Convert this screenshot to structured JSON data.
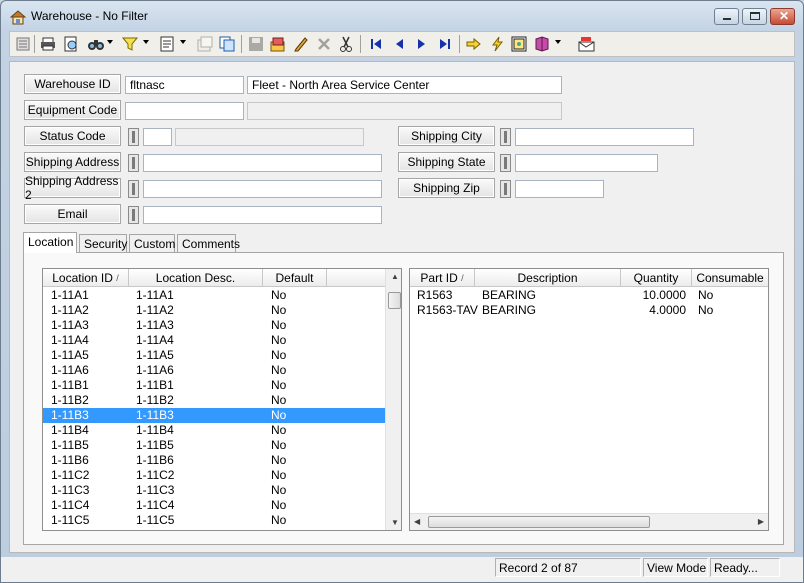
{
  "window": {
    "title": "Warehouse - No Filter"
  },
  "toolbar": {
    "icons": [
      "list-icon",
      "print-icon",
      "print-preview-icon",
      "binoculars-icon",
      "filter-icon",
      "report-icon",
      "properties-icon",
      "copy-icon",
      "save-icon",
      "new-record-icon",
      "edit-icon",
      "delete-icon",
      "cut-icon",
      "first-record-icon",
      "previous-record-icon",
      "next-record-icon",
      "last-record-icon",
      "arrow-action-icon",
      "lightning-icon",
      "picture-icon",
      "book-icon",
      "mail-icon"
    ]
  },
  "form": {
    "warehouse_id": {
      "label": "Warehouse ID",
      "value": "fltnasc",
      "description": "Fleet - North Area Service Center"
    },
    "equipment_code": {
      "label": "Equipment Code",
      "value": "",
      "description": ""
    },
    "status_code": {
      "label": "Status Code",
      "value": "",
      "description": ""
    },
    "shipping_address": {
      "label": "Shipping Address",
      "value": ""
    },
    "shipping_address2": {
      "label": "Shipping Address 2",
      "value": ""
    },
    "email": {
      "label": "Email",
      "value": ""
    },
    "shipping_city": {
      "label": "Shipping City",
      "value": ""
    },
    "shipping_state": {
      "label": "Shipping State",
      "value": ""
    },
    "shipping_zip": {
      "label": "Shipping Zip",
      "value": ""
    }
  },
  "tabs": [
    {
      "label": "Location",
      "active": true
    },
    {
      "label": "Security",
      "active": false
    },
    {
      "label": "Custom",
      "active": false
    },
    {
      "label": "Comments",
      "active": false
    }
  ],
  "location_grid": {
    "columns": [
      "Location ID",
      "Location Desc.",
      "Default"
    ],
    "sort_indicator": "/",
    "rows": [
      [
        "1-11A1",
        "1-11A1",
        "No"
      ],
      [
        "1-11A2",
        "1-11A2",
        "No"
      ],
      [
        "1-11A3",
        "1-11A3",
        "No"
      ],
      [
        "1-11A4",
        "1-11A4",
        "No"
      ],
      [
        "1-11A5",
        "1-11A5",
        "No"
      ],
      [
        "1-11A6",
        "1-11A6",
        "No"
      ],
      [
        "1-11B1",
        "1-11B1",
        "No"
      ],
      [
        "1-11B2",
        "1-11B2",
        "No"
      ],
      [
        "1-11B3",
        "1-11B3",
        "No"
      ],
      [
        "1-11B4",
        "1-11B4",
        "No"
      ],
      [
        "1-11B5",
        "1-11B5",
        "No"
      ],
      [
        "1-11B6",
        "1-11B6",
        "No"
      ],
      [
        "1-11C2",
        "1-11C2",
        "No"
      ],
      [
        "1-11C3",
        "1-11C3",
        "No"
      ],
      [
        "1-11C4",
        "1-11C4",
        "No"
      ],
      [
        "1-11C5",
        "1-11C5",
        "No"
      ]
    ],
    "selected_row": 8
  },
  "parts_grid": {
    "columns": [
      "Part ID",
      "Description",
      "Quantity",
      "Consumable"
    ],
    "sort_indicator": "/",
    "rows": [
      [
        "R1563",
        "BEARING",
        "10.0000",
        "No"
      ],
      [
        "R1563-TAV",
        "BEARING",
        "4.0000",
        "No"
      ]
    ]
  },
  "status_bar": {
    "record": "Record 2 of 87",
    "mode": "View Mode",
    "state": "Ready..."
  }
}
